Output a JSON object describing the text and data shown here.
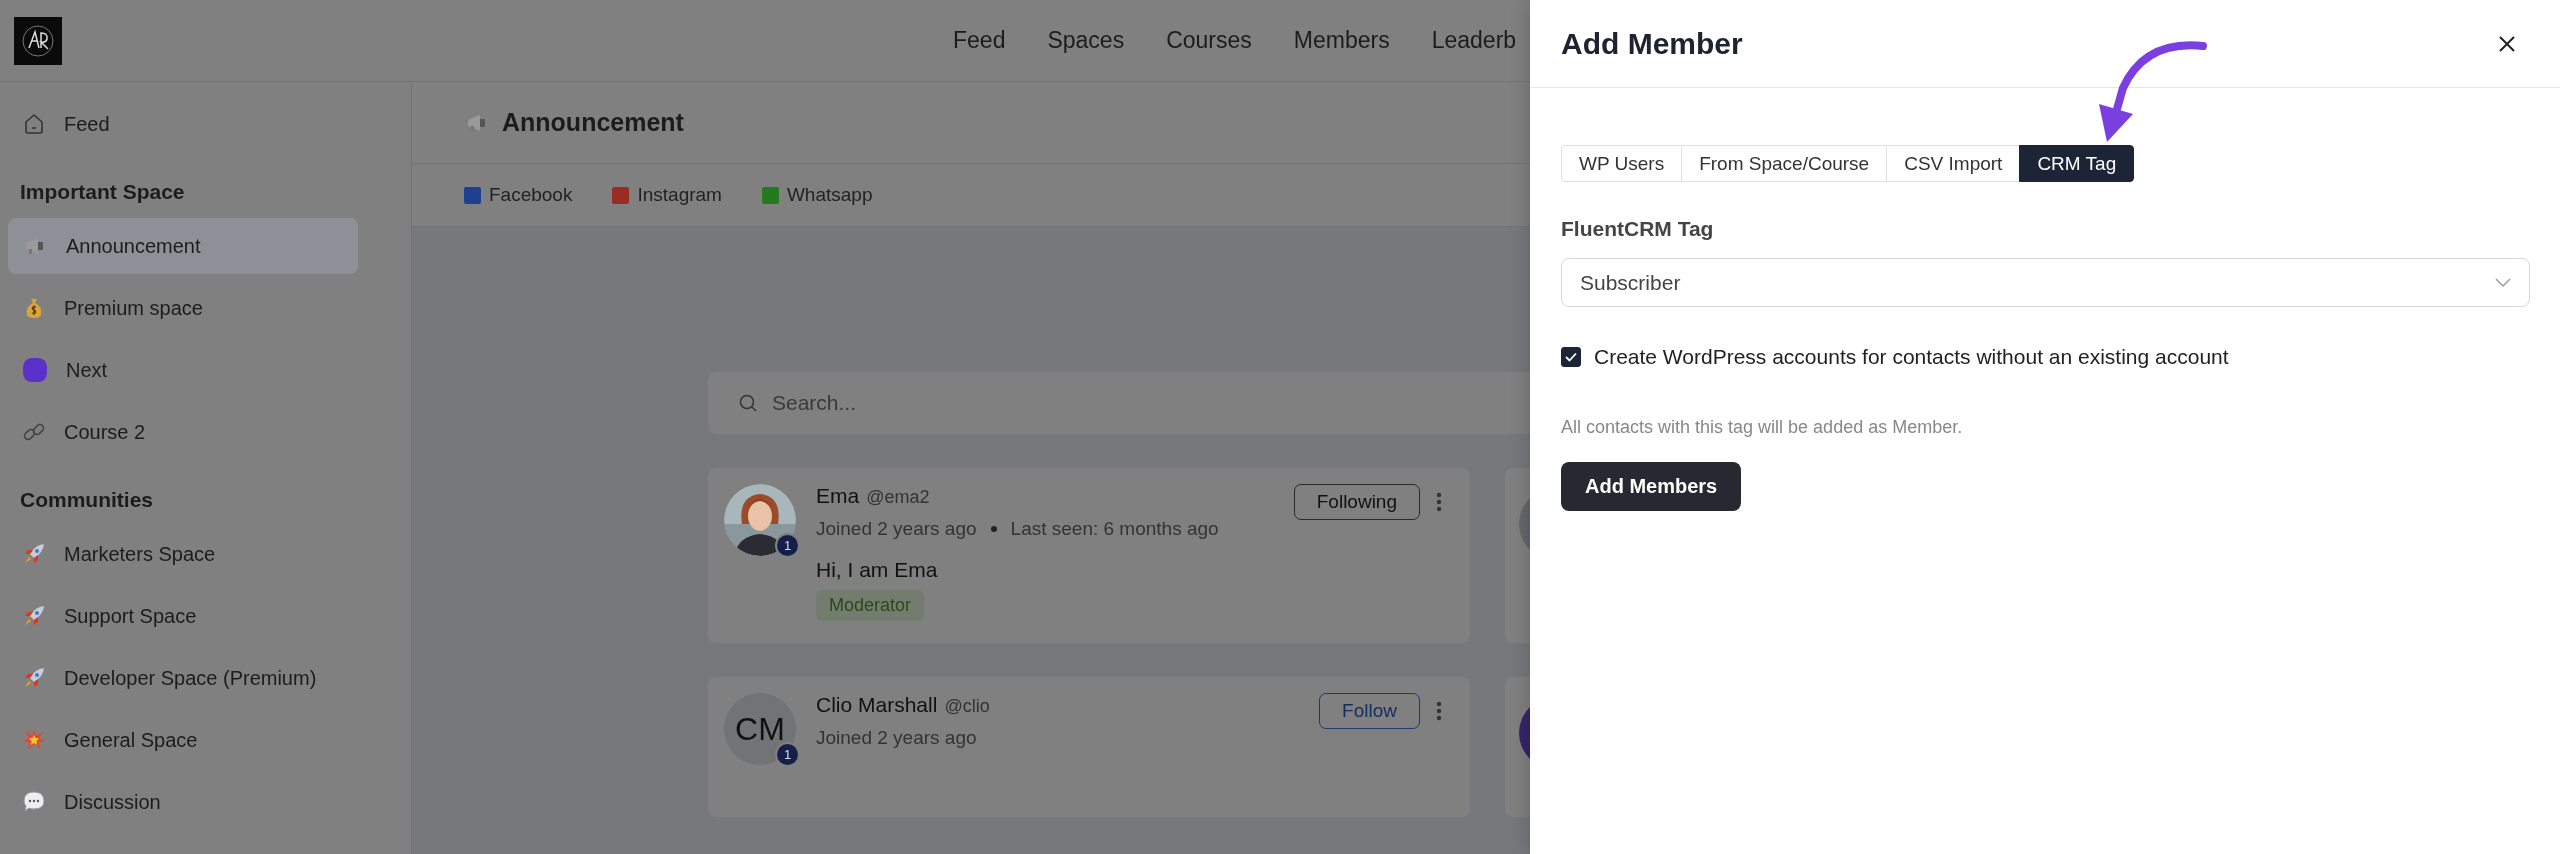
{
  "header": {
    "nav": [
      {
        "label": "Feed"
      },
      {
        "label": "Spaces"
      },
      {
        "label": "Courses"
      },
      {
        "label": "Members"
      },
      {
        "label": "Leaderb"
      }
    ]
  },
  "sidebar": {
    "items": [
      {
        "label": "Feed",
        "selected": false
      }
    ],
    "sections": [
      {
        "heading": "Important Space",
        "items": [
          {
            "label": "Announcement",
            "selected": true
          },
          {
            "label": "Premium space",
            "selected": false
          },
          {
            "label": "Next",
            "selected": false
          },
          {
            "label": "Course 2",
            "selected": false
          }
        ]
      },
      {
        "heading": "Communities",
        "items": [
          {
            "label": "Marketers Space",
            "selected": false
          },
          {
            "label": "Support Space",
            "selected": false
          },
          {
            "label": "Developer Space (Premium)",
            "selected": false
          },
          {
            "label": "General Space",
            "selected": false
          },
          {
            "label": "Discussion",
            "selected": false
          }
        ]
      }
    ]
  },
  "space": {
    "title": "Announcement",
    "links": [
      {
        "label": "Facebook",
        "color": "#1f3f8f"
      },
      {
        "label": "Instagram",
        "color": "#9a2c24"
      },
      {
        "label": "Whatsapp",
        "color": "#257a20"
      }
    ]
  },
  "search": {
    "placeholder": "Search..."
  },
  "members": [
    {
      "name": "Ema",
      "handle": "@ema2",
      "joined": "Joined 2 years ago",
      "last_seen": "Last seen: 6 months ago",
      "bio": "Hi, I am Ema",
      "role": "Moderator",
      "badge": "1",
      "follow": {
        "label": "Following",
        "following": true
      }
    },
    {
      "name": "Clio Marshall",
      "handle": "@clio",
      "joined": "Joined 2 years ago",
      "avatar": {
        "kind": "initials",
        "initials": "CM"
      },
      "badge": "1",
      "follow": {
        "label": "Follow",
        "following": false
      }
    }
  ],
  "drawer": {
    "title": "Add Member",
    "tabs": [
      {
        "label": "WP Users",
        "selected": false
      },
      {
        "label": "From Space/Course",
        "selected": false
      },
      {
        "label": "CSV Import",
        "selected": false
      },
      {
        "label": "CRM Tag",
        "selected": true
      }
    ],
    "field_label": "FluentCRM Tag",
    "select_value": "Subscriber",
    "checkbox": {
      "label": "Create WordPress accounts for contacts without an existing account",
      "checked": true
    },
    "help": "All contacts with this tag will be added as Member.",
    "submit": "Add Members"
  }
}
